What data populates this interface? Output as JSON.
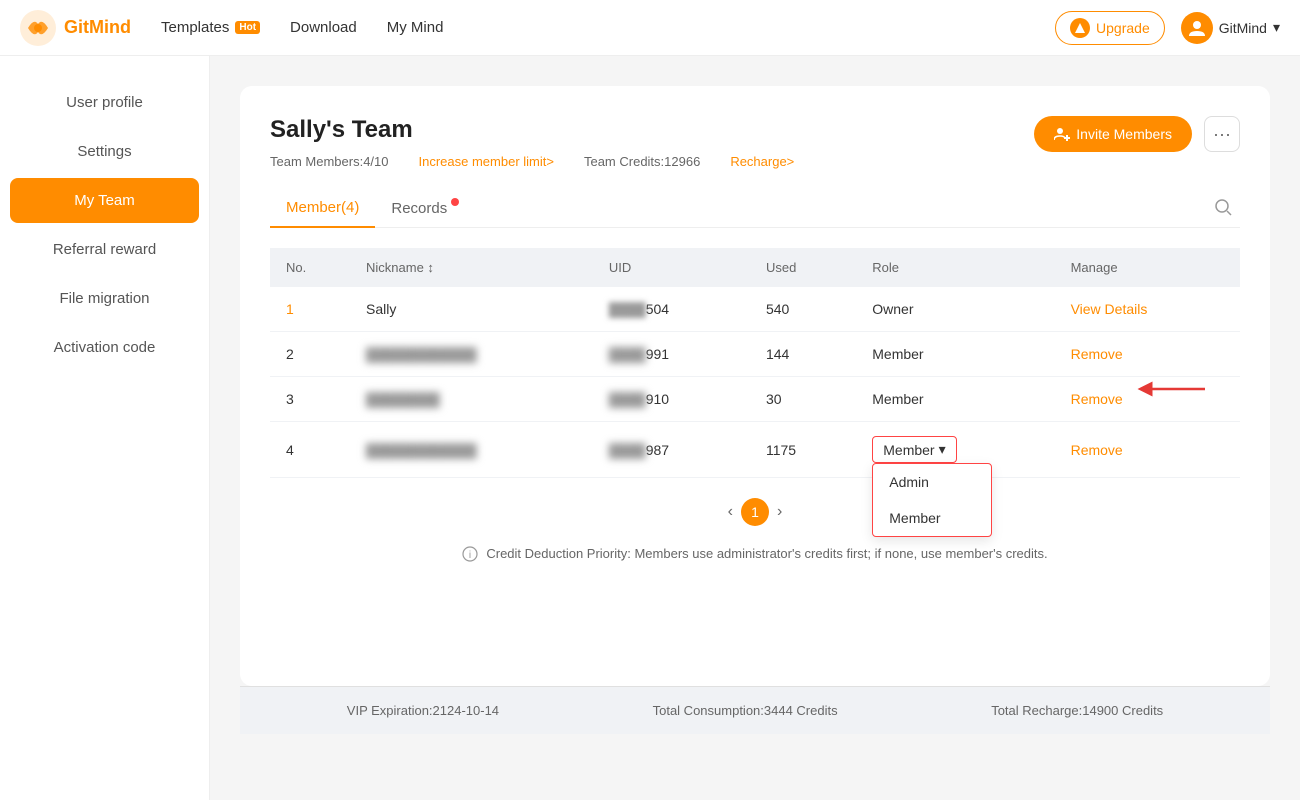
{
  "header": {
    "logo_text": "GitMind",
    "nav": [
      {
        "label": "Templates",
        "badge": "Hot"
      },
      {
        "label": "Download"
      },
      {
        "label": "My Mind"
      }
    ],
    "upgrade_label": "Upgrade",
    "user_label": "GitMind"
  },
  "sidebar": {
    "items": [
      {
        "label": "User profile",
        "active": false
      },
      {
        "label": "Settings",
        "active": false
      },
      {
        "label": "My Team",
        "active": true
      },
      {
        "label": "Referral reward",
        "active": false
      },
      {
        "label": "File migration",
        "active": false
      },
      {
        "label": "Activation code",
        "active": false
      }
    ]
  },
  "team": {
    "title": "Sally's Team",
    "members_text": "Team Members:4/10",
    "increase_link": "Increase member limit>",
    "credits_text": "Team Credits:12966",
    "recharge_link": "Recharge>",
    "invite_btn": "Invite Members",
    "tabs": [
      {
        "label": "Member(4)",
        "active": true
      },
      {
        "label": "Records",
        "badge": true
      }
    ],
    "table": {
      "headers": [
        "No.",
        "Nickname ↕",
        "UID",
        "Used",
        "Role",
        "Manage"
      ],
      "rows": [
        {
          "no": "1",
          "nickname": "Sally",
          "uid": "504",
          "used": "540",
          "role": "Owner",
          "manage": "View Details",
          "blurred_uid": false
        },
        {
          "no": "2",
          "nickname": "●●●●●●●●",
          "uid": "991",
          "used": "144",
          "role": "Member",
          "manage": "Remove",
          "blurred": true
        },
        {
          "no": "3",
          "nickname": "●●●●",
          "uid": "910",
          "used": "30",
          "role": "Member",
          "manage": "Remove",
          "blurred": true,
          "arrow": true
        },
        {
          "no": "4",
          "nickname": "●●●●●●●●●",
          "uid": "987",
          "used": "1175",
          "role": "Member",
          "manage": "Remove",
          "blurred": true,
          "dropdown": true
        }
      ]
    },
    "dropdown_options": [
      "Admin",
      "Member"
    ],
    "pagination": {
      "current": 1,
      "total": 1
    },
    "info_note": "Credit Deduction Priority: Members use administrator's credits first; if none, use member's credits."
  },
  "footer": {
    "vip_expiration": "VIP Expiration:2124-10-14",
    "total_consumption": "Total Consumption:3444 Credits",
    "total_recharge": "Total Recharge:14900 Credits"
  }
}
